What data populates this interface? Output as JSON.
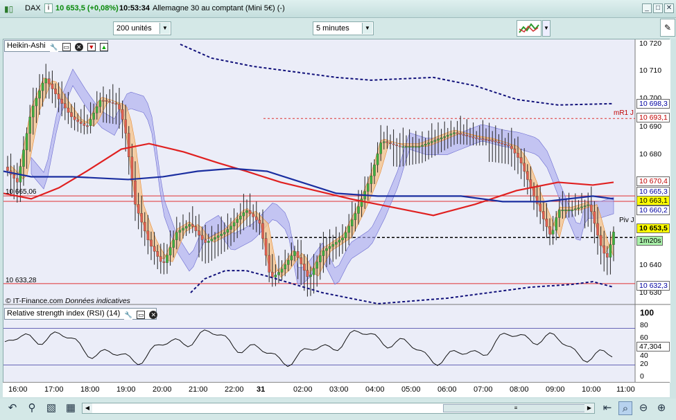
{
  "titlebar": {
    "instrument": "DAX",
    "price_change": "10 653,5 (+0,08%)",
    "time": "10:53:34",
    "description": "Allemagne 30 au comptant (Mini 5€) (-)",
    "minimize": "▭",
    "restore": "▭",
    "close": "✕"
  },
  "toolbar": {
    "units_value": "200 unités",
    "interval_value": "5 minutes"
  },
  "main_legend": {
    "label": "Heikin-Ashi"
  },
  "rsi_legend": {
    "label": "Relative strength index (RSI) (14)"
  },
  "main_annotations": {
    "copyright": "© IT-Finance.com",
    "disclaimer": "Données indicatives",
    "level_top": "10 665,06",
    "level_bottom": "10 633,28",
    "mr1": "mR1 J",
    "piv": "Piv J"
  },
  "price_axis": {
    "ticks": [
      "10 720",
      "10 710",
      "10 700",
      "10 690",
      "10 680",
      "10 640",
      "10 630"
    ],
    "boxes": [
      {
        "label": "10 698,3",
        "bg": "#ffffff",
        "fg": "#0000a0"
      },
      {
        "label": "10 693,1",
        "bg": "#ffffff",
        "fg": "#c00000"
      },
      {
        "label": "10 670,4",
        "bg": "#ffffff",
        "fg": "#c00000"
      },
      {
        "label": "10 665,3",
        "bg": "#ffffff",
        "fg": "#0000a0"
      },
      {
        "label": "10 663,1",
        "bg": "#ffff00",
        "fg": "#000000"
      },
      {
        "label": "10 660,2",
        "bg": "#ffffff",
        "fg": "#0000a0"
      },
      {
        "label": "10 653,5",
        "bg": "#ffff00",
        "fg": "#000000"
      },
      {
        "label": "1m20s",
        "bg": "#a8f0a8",
        "fg": "#000000"
      },
      {
        "label": "10 632,3",
        "bg": "#ffffff",
        "fg": "#0000a0"
      }
    ]
  },
  "rsi_axis": {
    "ticks": [
      "100",
      "80",
      "60",
      "40",
      "20",
      "0"
    ],
    "value": "47,304"
  },
  "time_axis": [
    "16:00",
    "17:00",
    "18:00",
    "19:00",
    "20:00",
    "21:00",
    "22:00",
    "31",
    "02:00",
    "03:00",
    "04:00",
    "05:00",
    "06:00",
    "07:00",
    "08:00",
    "09:00",
    "10:00",
    "11:00"
  ],
  "colors": {
    "bull": "#3fae3f",
    "bear": "#e06050",
    "ma_red": "#e02020",
    "ma_blue": "#1a2ea0",
    "band_fill": "#a8a8ee",
    "band_orange": "#f5c48e"
  }
}
